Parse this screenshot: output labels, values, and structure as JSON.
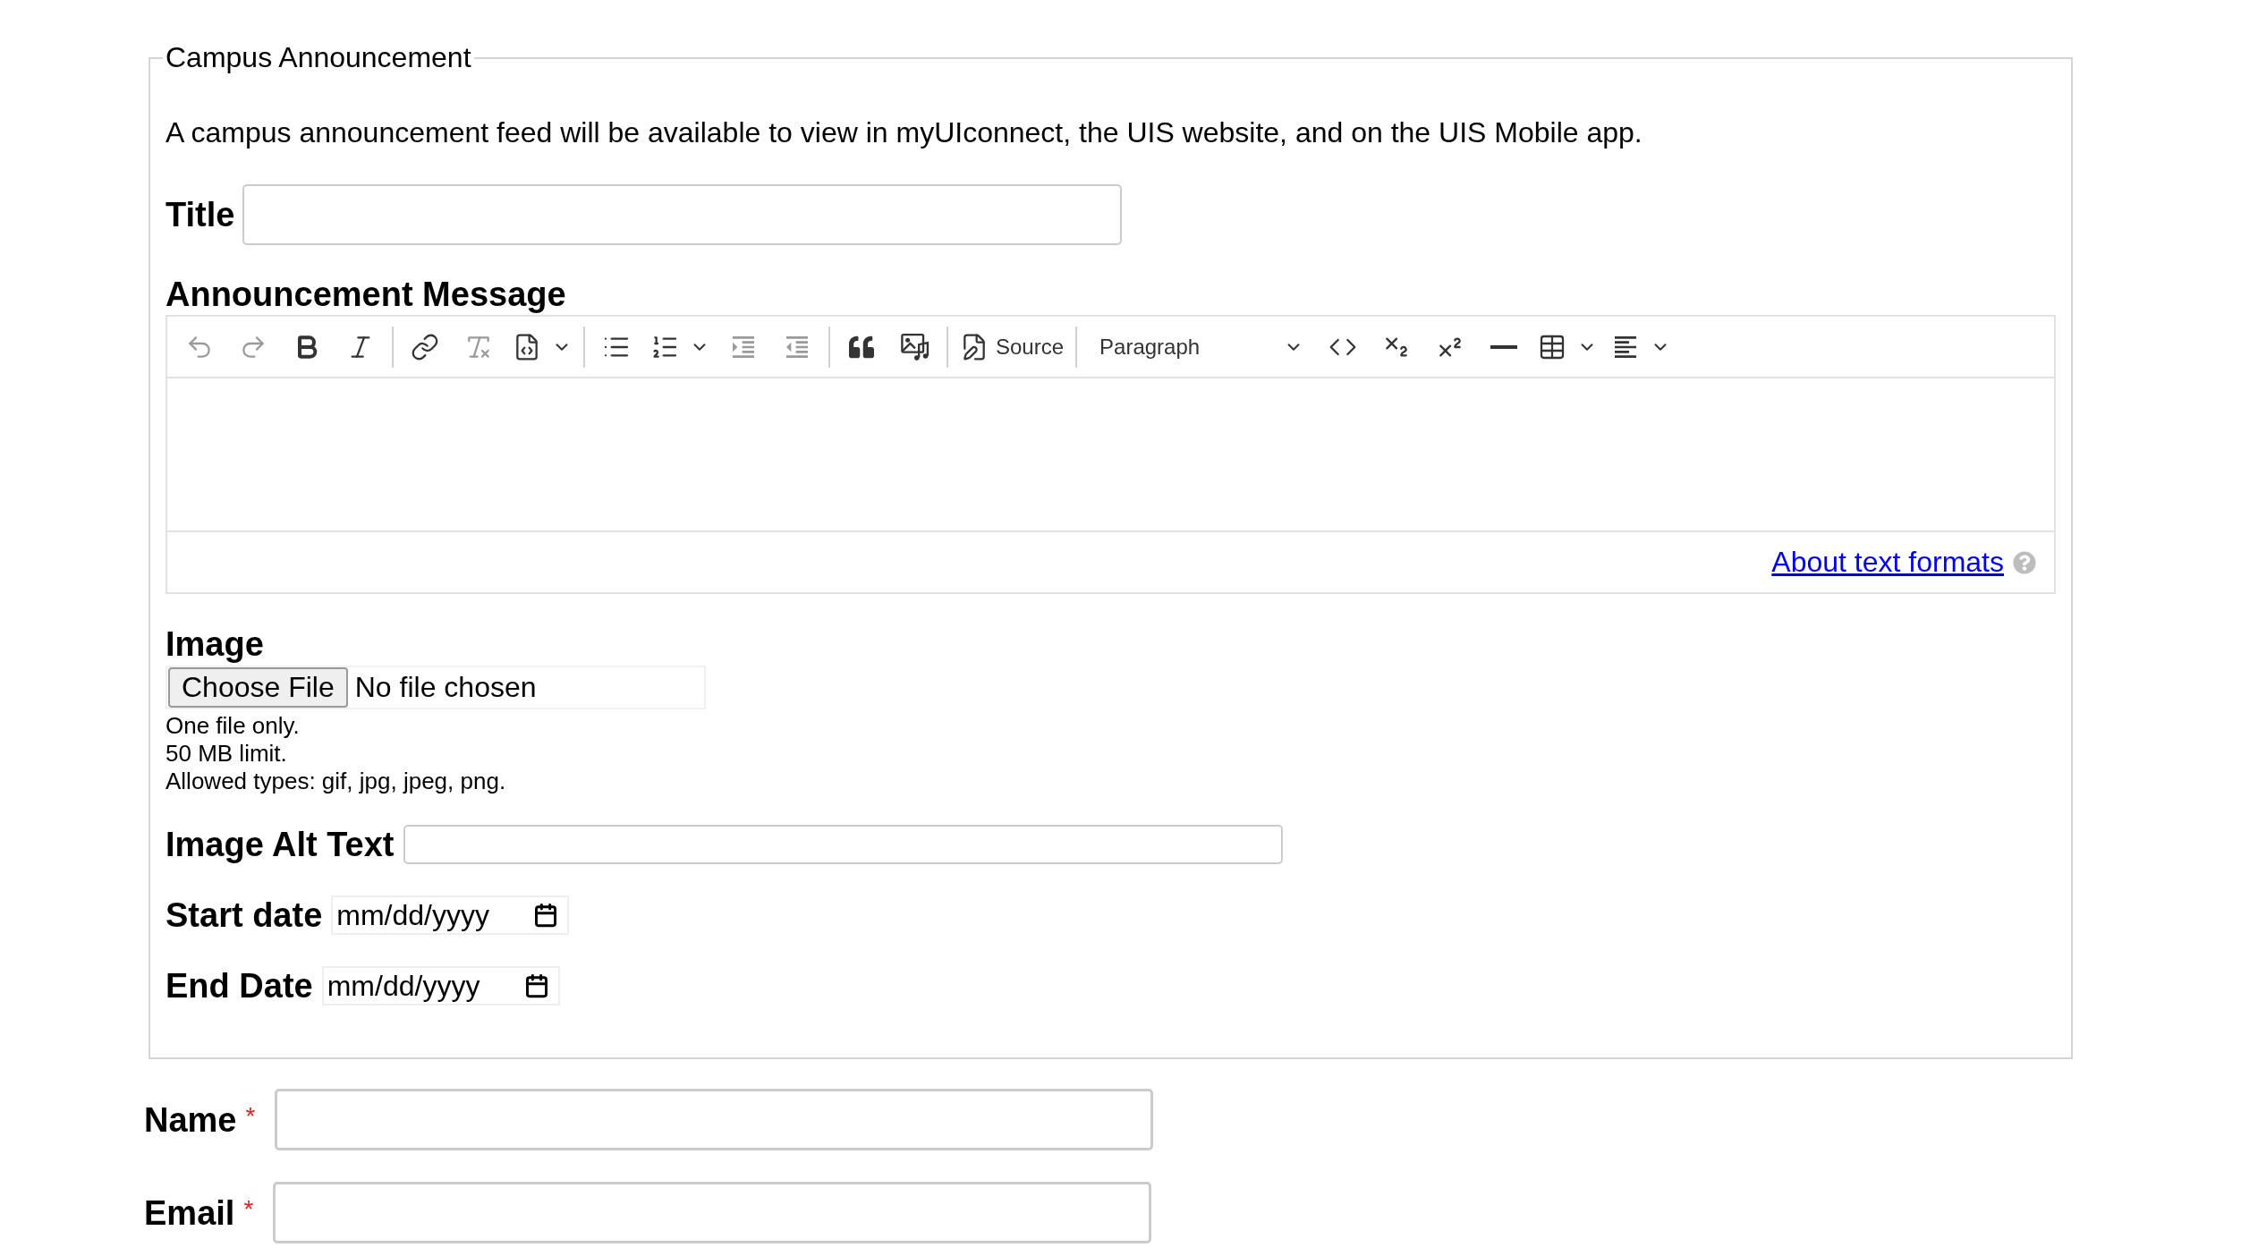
{
  "announcement": {
    "legend": "Campus Announcement",
    "description": "A campus announcement feed will be available to view in myUIconnect, the UIS website, and on the UIS Mobile app.",
    "title_field": {
      "label": "Title"
    },
    "message": {
      "label": "Announcement Message",
      "toolbar_groups": [
        [
          {
            "kind": "undo",
            "disabled": true
          },
          {
            "kind": "redo",
            "disabled": true
          },
          {
            "kind": "bold",
            "disabled": false
          },
          {
            "kind": "italic",
            "disabled": false
          }
        ],
        [
          {
            "kind": "link",
            "disabled": false
          },
          {
            "kind": "removeformat",
            "disabled": true
          },
          {
            "kind": "codeblock",
            "disabled": false
          }
        ],
        [
          {
            "kind": "bulletlist",
            "disabled": false
          },
          {
            "kind": "numberlist",
            "disabled": false
          },
          {
            "kind": "indent",
            "disabled": true
          },
          {
            "kind": "outdent",
            "disabled": true
          }
        ],
        [
          {
            "kind": "blockquote",
            "disabled": false
          },
          {
            "kind": "media",
            "disabled": false
          }
        ],
        [
          {
            "kind": "source",
            "label": "Source",
            "disabled": false
          }
        ],
        [
          {
            "kind": "heading",
            "label": "Paragraph",
            "disabled": false
          },
          {
            "kind": "code",
            "disabled": false
          },
          {
            "kind": "subscript",
            "disabled": false
          },
          {
            "kind": "superscript",
            "disabled": false
          },
          {
            "kind": "rule",
            "disabled": false
          },
          {
            "kind": "table",
            "disabled": false
          },
          {
            "kind": "align",
            "disabled": false
          }
        ]
      ],
      "footer_link": "About text formats"
    },
    "image": {
      "label": "Image",
      "button": "Choose File",
      "status": "No file chosen",
      "notes": [
        "One file only.",
        "50 MB limit.",
        "Allowed types: gif, jpg, jpeg, png."
      ]
    },
    "alt_text": {
      "label": "Image Alt Text"
    },
    "dates": [
      {
        "label": "Start date",
        "placeholder": "mm/dd/yyyy"
      },
      {
        "label": "End Date",
        "placeholder": "mm/dd/yyyy"
      }
    ]
  },
  "contact_fields": [
    {
      "label": "Name",
      "required_mark": "*"
    },
    {
      "label": "Email",
      "required_mark": "*"
    }
  ]
}
